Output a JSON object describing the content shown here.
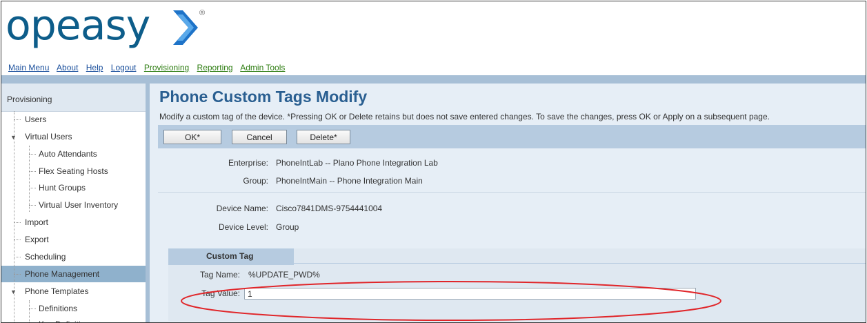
{
  "brand": {
    "logo_text": "opeasy",
    "registered": "®",
    "primary_color": "#0d5d8a",
    "accent_color": "#2e7dd1"
  },
  "topnav": {
    "items": [
      {
        "label": "Main Menu"
      },
      {
        "label": "About"
      },
      {
        "label": "Help"
      },
      {
        "label": "Logout"
      },
      {
        "label": "Provisioning"
      },
      {
        "label": "Reporting"
      },
      {
        "label": "Admin Tools"
      }
    ]
  },
  "sidebar": {
    "header": "Provisioning",
    "items": [
      {
        "label": "Users"
      },
      {
        "label": "Virtual Users"
      },
      {
        "label": "Auto Attendants"
      },
      {
        "label": "Flex Seating Hosts"
      },
      {
        "label": "Hunt Groups"
      },
      {
        "label": "Virtual User Inventory"
      },
      {
        "label": "Import"
      },
      {
        "label": "Export"
      },
      {
        "label": "Scheduling"
      },
      {
        "label": "Phone Management"
      },
      {
        "label": "Phone Templates"
      },
      {
        "label": "Definitions"
      },
      {
        "label": "Key Definitions"
      }
    ]
  },
  "page": {
    "title": "Phone Custom Tags Modify",
    "description": "Modify a custom tag of the device. *Pressing OK or Delete retains but does not save entered changes. To save the changes, press OK or Apply on a subsequent page."
  },
  "buttons": {
    "ok": "OK*",
    "cancel": "Cancel",
    "delete": "Delete*"
  },
  "info": {
    "enterprise_label": "Enterprise:",
    "enterprise_value": "PhoneIntLab -- Plano Phone Integration Lab",
    "group_label": "Group:",
    "group_value": "PhoneIntMain -- Phone Integration Main",
    "device_name_label": "Device Name:",
    "device_name_value": "Cisco7841DMS-9754441004",
    "device_level_label": "Device Level:",
    "device_level_value": "Group"
  },
  "custom_tag": {
    "tab_label": "Custom Tag",
    "tag_name_label": "Tag Name:",
    "tag_name_value": "%UPDATE_PWD%",
    "tag_value_label": "Tag Value:",
    "tag_value": "1"
  },
  "highlight_color": "#e0262a"
}
